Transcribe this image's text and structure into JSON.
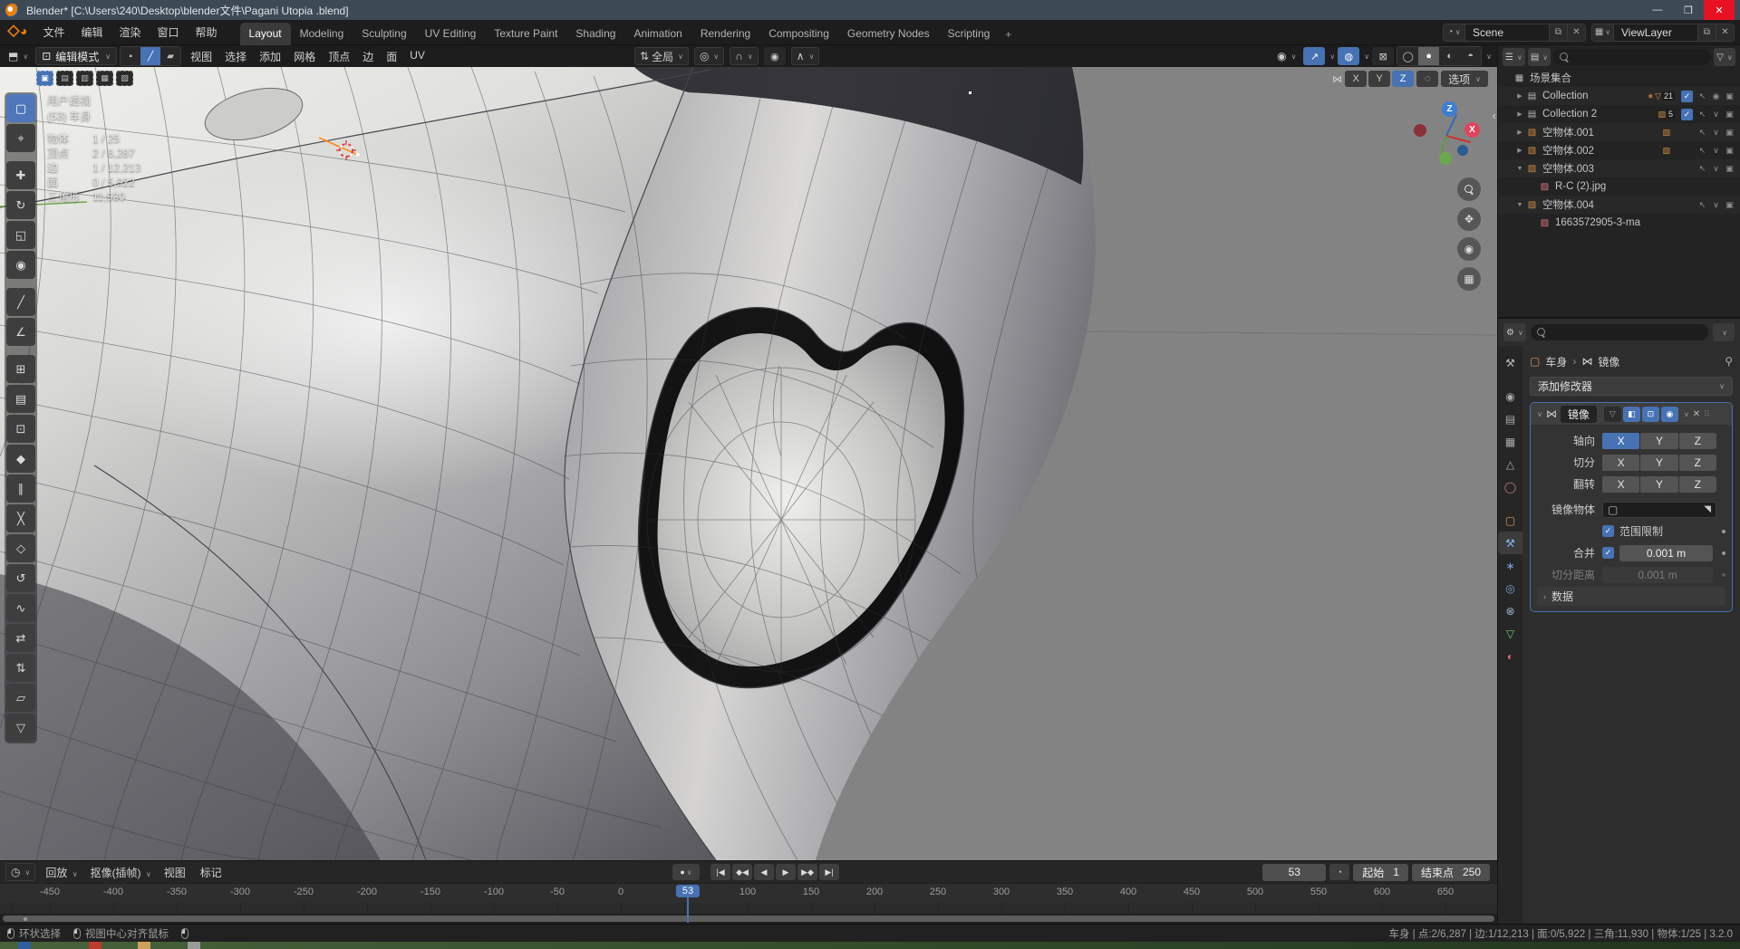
{
  "titlebar": {
    "title": "Blender* [C:\\Users\\240\\Desktop\\blender文件\\Pagani Utopia .blend]",
    "minimize": "—",
    "maximize": "❐",
    "close": "✕"
  },
  "menubar": {
    "menus": [
      {
        "label": "文件"
      },
      {
        "label": "编辑"
      },
      {
        "label": "渲染"
      },
      {
        "label": "窗口"
      },
      {
        "label": "帮助"
      }
    ],
    "tabs": [
      {
        "label": "Layout",
        "cls": "active"
      },
      {
        "label": "Modeling",
        "cls": ""
      },
      {
        "label": "Sculpting",
        "cls": ""
      },
      {
        "label": "UV Editing",
        "cls": ""
      },
      {
        "label": "Texture Paint",
        "cls": ""
      },
      {
        "label": "Shading",
        "cls": ""
      },
      {
        "label": "Animation",
        "cls": ""
      },
      {
        "label": "Rendering",
        "cls": ""
      },
      {
        "label": "Compositing",
        "cls": ""
      },
      {
        "label": "Geometry Nodes",
        "cls": ""
      },
      {
        "label": "Scripting",
        "cls": ""
      },
      {
        "label": "+",
        "cls": "plus"
      }
    ],
    "scene": {
      "value": "Scene"
    },
    "view_layer": {
      "value": "ViewLayer"
    }
  },
  "viewport": {
    "header": {
      "mode": "编辑模式",
      "menus": [
        {
          "label": "视图"
        },
        {
          "label": "选择"
        },
        {
          "label": "添加"
        },
        {
          "label": "网格"
        },
        {
          "label": "顶点"
        },
        {
          "label": "边"
        },
        {
          "label": "面"
        },
        {
          "label": "UV"
        }
      ],
      "orientation": "全局",
      "select_modes": [
        {
          "glyph": "▪",
          "cls": ""
        },
        {
          "glyph": "╱",
          "cls": "on"
        },
        {
          "glyph": "▰",
          "cls": ""
        }
      ],
      "shading": [
        {
          "glyph": "◯",
          "cls": ""
        },
        {
          "glyph": "●",
          "cls": "on"
        },
        {
          "glyph": "◐",
          "cls": ""
        },
        {
          "glyph": "◓",
          "cls": ""
        }
      ]
    },
    "axes_row": {
      "buttons": [
        {
          "label": "X",
          "cls": ""
        },
        {
          "label": "Y",
          "cls": ""
        },
        {
          "label": "Z",
          "cls": "on"
        }
      ],
      "options_label": "选项"
    },
    "select_options": [
      {
        "glyph": "▣",
        "cls": "on"
      },
      {
        "glyph": "▤",
        "cls": ""
      },
      {
        "glyph": "▥",
        "cls": ""
      },
      {
        "glyph": "▦",
        "cls": ""
      },
      {
        "glyph": "▧",
        "cls": ""
      }
    ],
    "stats": {
      "view_name": "用户透视",
      "object_name": "(53) 车身",
      "rows": [
        {
          "k": "物体",
          "v": "1 / 25"
        },
        {
          "k": "顶点",
          "v": "2 / 6,287"
        },
        {
          "k": "边",
          "v": "1 / 12,213"
        },
        {
          "k": "面",
          "v": "0 / 5,922"
        },
        {
          "k": "三角形",
          "v": "11,930"
        }
      ]
    },
    "gizmo": {
      "z_label": "Z",
      "x_label": "X"
    }
  },
  "toolbar": {
    "tools": [
      {
        "name": "box-select",
        "glyph": "▢",
        "cls": "active"
      },
      {
        "name": "cursor",
        "glyph": "⌖",
        "cls": ""
      },
      {
        "name": "move",
        "glyph": "✚",
        "cls": "gap"
      },
      {
        "name": "rotate",
        "glyph": "↻",
        "cls": ""
      },
      {
        "name": "scale",
        "glyph": "◱",
        "cls": ""
      },
      {
        "name": "transform",
        "glyph": "◉",
        "cls": ""
      },
      {
        "name": "annotate",
        "glyph": "╱",
        "cls": "gap"
      },
      {
        "name": "measure",
        "glyph": "∠",
        "cls": ""
      },
      {
        "name": "add-cube",
        "glyph": "⊞",
        "cls": "gap"
      },
      {
        "name": "extrude-region",
        "glyph": "▤",
        "cls": ""
      },
      {
        "name": "inset-faces",
        "glyph": "⊡",
        "cls": ""
      },
      {
        "name": "bevel",
        "glyph": "◆",
        "cls": ""
      },
      {
        "name": "loop-cut",
        "glyph": "∥",
        "cls": ""
      },
      {
        "name": "knife",
        "glyph": "╳",
        "cls": ""
      },
      {
        "name": "poly-build",
        "glyph": "◇",
        "cls": ""
      },
      {
        "name": "spin",
        "glyph": "↺",
        "cls": ""
      },
      {
        "name": "smooth",
        "glyph": "∿",
        "cls": ""
      },
      {
        "name": "edge-slide",
        "glyph": "⇄",
        "cls": ""
      },
      {
        "name": "shrink-fatten",
        "glyph": "⇅",
        "cls": ""
      },
      {
        "name": "shear",
        "glyph": "▱",
        "cls": ""
      },
      {
        "name": "rip-region",
        "glyph": "▽",
        "cls": ""
      }
    ]
  },
  "outliner": {
    "title": "场景集合",
    "rows": [
      {
        "indent": 0,
        "expand": "",
        "icon": "▦",
        "icon_cls": "ic-gray",
        "label": "场景集合",
        "badge_pre": "",
        "badge_glyph": "",
        "badge": "",
        "check": "",
        "t_sel": "",
        "t_vis": "",
        "t_cam": ""
      },
      {
        "indent": 1,
        "expand": "▶",
        "icon": "▤",
        "icon_cls": "ic-gray",
        "label": "Collection",
        "badge_pre": "∗",
        "badge_glyph": "▽",
        "badge": "21",
        "check": "✓",
        "t_sel": "↖",
        "t_vis": "◉",
        "t_cam": "▣"
      },
      {
        "indent": 1,
        "expand": "▶",
        "icon": "▤",
        "icon_cls": "ic-gray",
        "label": "Collection 2",
        "badge_pre": "",
        "badge_glyph": "▨",
        "badge": "5",
        "check": "✓",
        "t_sel": "↖",
        "t_vis": "∨",
        "t_cam": "▣"
      },
      {
        "indent": 1,
        "expand": "▶",
        "icon": "▧",
        "icon_cls": "ic-orange",
        "label": "空物体.001",
        "badge_pre": "",
        "badge_glyph": "▨",
        "badge": "",
        "check": "",
        "t_sel": "↖",
        "t_vis": "∨",
        "t_cam": "▣"
      },
      {
        "indent": 1,
        "expand": "▶",
        "icon": "▧",
        "icon_cls": "ic-orange",
        "label": "空物体.002",
        "badge_pre": "",
        "badge_glyph": "▨",
        "badge": "",
        "check": "",
        "t_sel": "↖",
        "t_vis": "∨",
        "t_cam": "▣"
      },
      {
        "indent": 1,
        "expand": "▼",
        "icon": "▧",
        "icon_cls": "ic-orange",
        "label": "空物体.003",
        "badge_pre": "",
        "badge_glyph": "",
        "badge": "",
        "check": "",
        "t_sel": "↖",
        "t_vis": "∨",
        "t_cam": "▣"
      },
      {
        "indent": 2,
        "expand": "",
        "icon": "▨",
        "icon_cls": "ic-pink",
        "label": "R-C (2).jpg",
        "badge_pre": "",
        "badge_glyph": "",
        "badge": "",
        "check": "",
        "t_sel": "",
        "t_vis": "",
        "t_cam": ""
      },
      {
        "indent": 1,
        "expand": "▼",
        "icon": "▧",
        "icon_cls": "ic-orange",
        "label": "空物体.004",
        "badge_pre": "",
        "badge_glyph": "",
        "badge": "",
        "check": "",
        "t_sel": "↖",
        "t_vis": "∨",
        "t_cam": "▣"
      },
      {
        "indent": 2,
        "expand": "",
        "icon": "▨",
        "icon_cls": "ic-pink",
        "label": "1663572905-3-ma",
        "badge_pre": "",
        "badge_glyph": "",
        "badge": "",
        "check": "",
        "t_sel": "",
        "t_vis": "",
        "t_cam": ""
      }
    ]
  },
  "properties": {
    "tabs": [
      {
        "name": "tool",
        "glyph": "⚒",
        "cls": "",
        "style": "color:#b9b9b9"
      },
      {
        "name": "render",
        "glyph": "◉",
        "cls": "gap",
        "style": "color:#a9a9a9"
      },
      {
        "name": "output",
        "glyph": "▤",
        "cls": "",
        "style": "color:#a9a9a9"
      },
      {
        "name": "view-layer",
        "glyph": "▦",
        "cls": "",
        "style": "color:#a9a9a9"
      },
      {
        "name": "scene",
        "glyph": "△",
        "cls": "",
        "style": "color:#a9a9a9"
      },
      {
        "name": "world",
        "glyph": "◯",
        "cls": "",
        "style": "color:#c77"
      },
      {
        "name": "object",
        "glyph": "▢",
        "cls": "gap",
        "style": "color:#e39658"
      },
      {
        "name": "modifiers",
        "glyph": "⚒",
        "cls": "active",
        "style": "color:#86b2ec"
      },
      {
        "name": "particles",
        "glyph": "∗",
        "cls": "",
        "style": "color:#7aa2d8"
      },
      {
        "name": "physics",
        "glyph": "◎",
        "cls": "",
        "style": "color:#7aa2d8"
      },
      {
        "name": "constraints",
        "glyph": "⊗",
        "cls": "",
        "style": "color:#9fb6d4"
      },
      {
        "name": "object-data",
        "glyph": "▽",
        "cls": "",
        "style": "color:#6fca6f"
      },
      {
        "name": "material",
        "glyph": "◐",
        "cls": "",
        "style": "color:#e06c6c"
      }
    ],
    "breadcrumb": {
      "object": "车身",
      "sep": "›",
      "modifier": "镜像"
    },
    "add_modifier": "添加修改器",
    "modifier": {
      "name": "镜像",
      "toggles": [
        {
          "name": "display-on-cage",
          "glyph": "▽",
          "cls": ""
        },
        {
          "name": "display-edit-mode",
          "glyph": "◧",
          "cls": "on"
        },
        {
          "name": "display-viewport",
          "glyph": "⊡",
          "cls": "on"
        },
        {
          "name": "display-render",
          "glyph": "◉",
          "cls": "on"
        }
      ],
      "rows": {
        "axis": {
          "label": "轴向",
          "buttons": [
            {
              "t": "X",
              "cls": "on"
            },
            {
              "t": "Y",
              "cls": ""
            },
            {
              "t": "Z",
              "cls": ""
            }
          ]
        },
        "bisect": {
          "label": "切分",
          "buttons": [
            {
              "t": "X",
              "cls": ""
            },
            {
              "t": "Y",
              "cls": ""
            },
            {
              "t": "Z",
              "cls": ""
            }
          ]
        },
        "flip": {
          "label": "翻转",
          "buttons": [
            {
              "t": "X",
              "cls": ""
            },
            {
              "t": "Y",
              "cls": ""
            },
            {
              "t": "Z",
              "cls": ""
            }
          ]
        },
        "mirror_object": {
          "label": "镜像物体"
        },
        "clipping": {
          "label": "范围限制",
          "checked": "✓"
        },
        "merge": {
          "label": "合并",
          "checked": "✓",
          "value": "0.001 m"
        },
        "bisect_distance": {
          "label": "切分距离",
          "value": "0.001 m"
        },
        "data_subpanel": "数据"
      }
    }
  },
  "timeline": {
    "menus": [
      {
        "label": "回放",
        "chev": "∨"
      },
      {
        "label": "抠像(插帧)",
        "chev": "∨"
      },
      {
        "label": "视图",
        "chev": ""
      },
      {
        "label": "标记",
        "chev": ""
      }
    ],
    "transport": [
      {
        "name": "jump-to-start",
        "glyph": "|◀"
      },
      {
        "name": "prev-keyframe",
        "glyph": "◆◀"
      },
      {
        "name": "play-reverse",
        "glyph": "◀"
      },
      {
        "name": "play",
        "glyph": "▶"
      },
      {
        "name": "next-keyframe",
        "glyph": "▶◆"
      },
      {
        "name": "jump-to-end",
        "glyph": "▶|"
      }
    ],
    "current_frame": "53",
    "start_label": "起始",
    "start_value": "1",
    "end_label": "结束点",
    "end_value": "250",
    "playhead": {
      "label": "53",
      "style": "left:759px"
    },
    "ticks": [
      {
        "label": "-450",
        "style": "left:55px"
      },
      {
        "label": "-400",
        "style": "left:125px"
      },
      {
        "label": "-350",
        "style": "left:195px"
      },
      {
        "label": "-300",
        "style": "left:265px"
      },
      {
        "label": "-250",
        "style": "left:335px"
      },
      {
        "label": "-200",
        "style": "left:405px"
      },
      {
        "label": "-150",
        "style": "left:475px"
      },
      {
        "label": "-100",
        "style": "left:545px"
      },
      {
        "label": "-50",
        "style": "left:615px"
      },
      {
        "label": "0",
        "style": "left:685px"
      },
      {
        "label": "100",
        "style": "left:825px"
      },
      {
        "label": "150",
        "style": "left:895px"
      },
      {
        "label": "200",
        "style": "left:965px"
      },
      {
        "label": "250",
        "style": "left:1035px"
      },
      {
        "label": "300",
        "style": "left:1105px"
      },
      {
        "label": "350",
        "style": "left:1175px"
      },
      {
        "label": "400",
        "style": "left:1245px"
      },
      {
        "label": "450",
        "style": "left:1315px"
      },
      {
        "label": "500",
        "style": "left:1385px"
      },
      {
        "label": "550",
        "style": "left:1455px"
      },
      {
        "label": "600",
        "style": "left:1525px"
      },
      {
        "label": "650",
        "style": "left:1595px"
      }
    ]
  },
  "statusbar": {
    "left": [
      {
        "label": "环状选择"
      },
      {
        "label": "视图中心对齐鼠标"
      },
      {
        "label": ""
      }
    ],
    "right": "车身 | 点:2/6,287 | 边:1/12,213 | 面:0/5,922 | 三角:11,930 | 物体:1/25 | 3.2.0"
  }
}
